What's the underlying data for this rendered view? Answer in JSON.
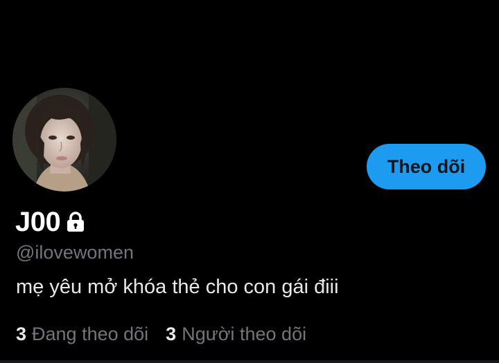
{
  "profile": {
    "display_name": "J00",
    "handle": "@ilovewomen",
    "bio": "mẹ yêu mở khóa thẻ cho con gái điii",
    "protected": true,
    "follow_button_label": "Theo dõi",
    "following_count": "3",
    "following_label": "Đang theo dõi",
    "followers_count": "3",
    "followers_label": "Người theo dõi"
  },
  "icons": {
    "lock": "lock-icon"
  },
  "colors": {
    "background": "#000000",
    "accent": "#1d9bf0",
    "primary_text": "#e7e9ea",
    "secondary_text": "#71767b"
  }
}
